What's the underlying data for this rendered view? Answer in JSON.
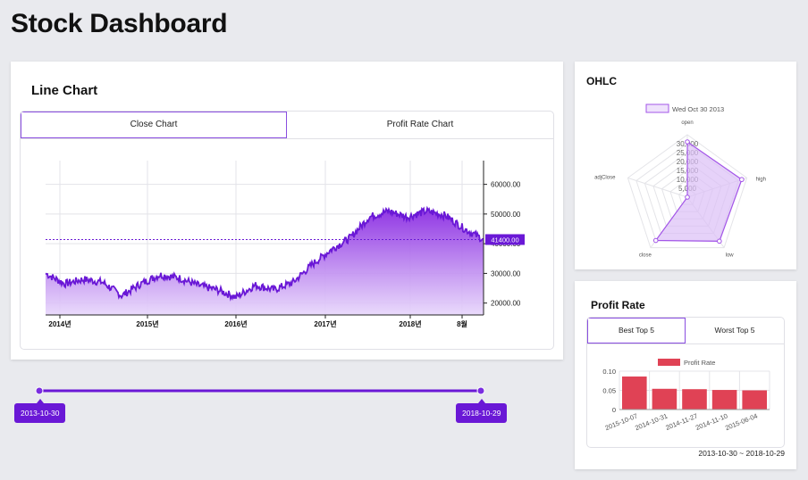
{
  "page_title": "Stock Dashboard",
  "line_card": {
    "title": "Line Chart",
    "tabs": [
      "Close Chart",
      "Profit Rate Chart"
    ],
    "active_tab": 0,
    "current_value_label": "41400.00"
  },
  "ohlc_card": {
    "title": "OHLC"
  },
  "profit_card": {
    "title": "Profit Rate",
    "tabs": [
      "Best Top 5",
      "Worst Top 5"
    ],
    "active_tab": 0,
    "range_text": "2013-10-30 ~ 2018-10-29"
  },
  "range_slider": {
    "start_label": "2013-10-30",
    "end_label": "2018-10-29",
    "start_fraction": 0.0,
    "end_fraction": 1.0
  },
  "colors": {
    "accent": "#6a18d6",
    "line": "#6a18d6",
    "radar_stroke": "#a355e8",
    "bar": "#e04255"
  },
  "chart_data": [
    {
      "type": "area",
      "x_tick_labels": [
        "2014년",
        "2015년",
        "2016년",
        "2017년",
        "2018년",
        "8월"
      ],
      "y_tick_labels": [
        "60000.00",
        "50000.00",
        "40000.00",
        "30000.00",
        "20000.00"
      ],
      "y_ticks": [
        60000,
        50000,
        40000,
        30000,
        20000
      ],
      "ylim": [
        16000,
        68000
      ],
      "reference_value": 41400,
      "x": [
        "2013-10",
        "2014-01",
        "2014-04",
        "2014-07",
        "2014-10",
        "2015-01",
        "2015-04",
        "2015-07",
        "2015-10",
        "2016-01",
        "2016-04",
        "2016-07",
        "2016-10",
        "2017-01",
        "2017-04",
        "2017-07",
        "2017-10",
        "2017-12",
        "2018-01",
        "2018-03",
        "2018-05",
        "2018-07",
        "2018-09",
        "2018-10"
      ],
      "values": [
        30000,
        26500,
        28000,
        27000,
        22500,
        26500,
        29500,
        28500,
        26000,
        24500,
        22000,
        26000,
        24500,
        27000,
        33000,
        38000,
        42000,
        49000,
        51000,
        49000,
        51000,
        49500,
        45000,
        41400
      ],
      "grid": true
    },
    {
      "type": "radar",
      "legend": [
        "Wed Oct 30 2013"
      ],
      "legend_placement": "top",
      "axes": [
        "open",
        "high",
        "low",
        "close",
        "adjClose"
      ],
      "scale_tick_labels": [
        "30,000",
        "25,000",
        "20,000",
        "15,000",
        "10,000",
        "5,000"
      ],
      "rmax": 35000,
      "values": [
        31000,
        32000,
        30500,
        30000,
        0
      ]
    },
    {
      "type": "bar",
      "categories": [
        "2015-10-07",
        "2014-10-31",
        "2014-11-27",
        "2014-11-10",
        "2015-06-04"
      ],
      "series": [
        {
          "name": "Profit Rate",
          "values": [
            0.086,
            0.054,
            0.053,
            0.051,
            0.05
          ]
        }
      ],
      "ylim": [
        0,
        0.1
      ],
      "y_tick_labels": [
        "0.10",
        "0.05",
        "0"
      ],
      "y_ticks": [
        0.1,
        0.05,
        0
      ],
      "legend_placement": "top",
      "grid": true
    }
  ]
}
